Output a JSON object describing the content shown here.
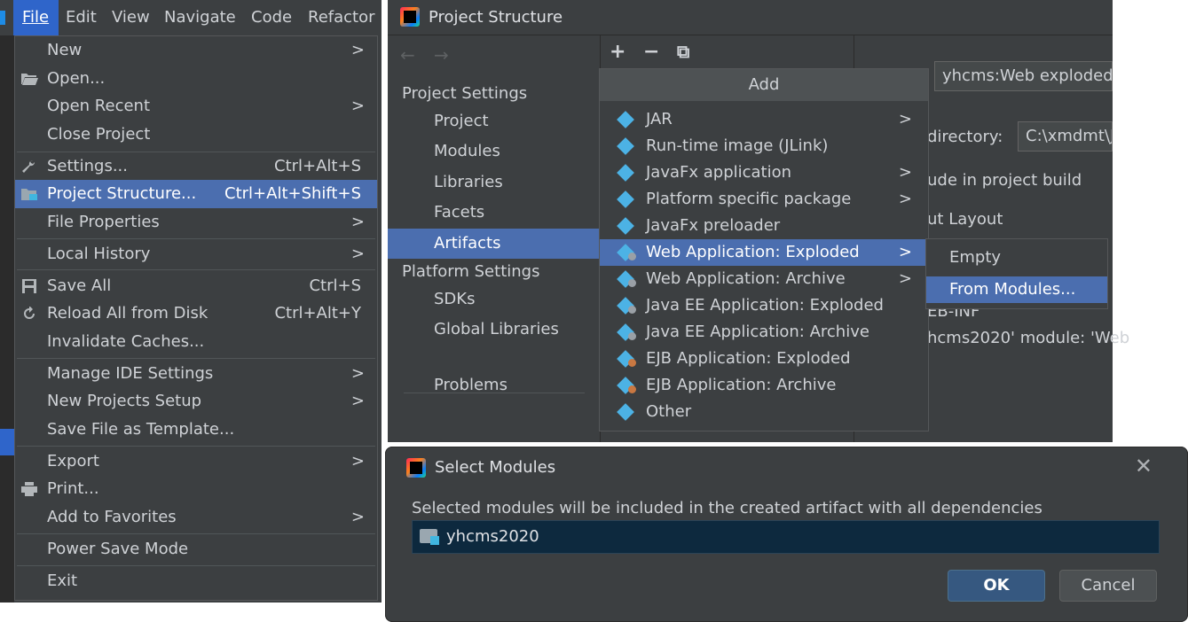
{
  "menubar": {
    "items": [
      "File",
      "Edit",
      "View",
      "Navigate",
      "Code",
      "Refactor"
    ],
    "active": "File"
  },
  "file_menu": {
    "items": [
      {
        "label": "New",
        "shortcut": "",
        "submenu": true,
        "icon": ""
      },
      {
        "label": "Open...",
        "shortcut": "",
        "submenu": false,
        "icon": "folder-open-icon"
      },
      {
        "label": "Open Recent",
        "shortcut": "",
        "submenu": true,
        "icon": ""
      },
      {
        "label": "Close Project",
        "shortcut": "",
        "submenu": false,
        "icon": ""
      },
      {
        "label": "Settings...",
        "shortcut": "Ctrl+Alt+S",
        "submenu": false,
        "icon": "wrench-icon"
      },
      {
        "label": "Project Structure...",
        "shortcut": "Ctrl+Alt+Shift+S",
        "submenu": false,
        "icon": "project-structure-icon",
        "selected": true
      },
      {
        "label": "File Properties",
        "shortcut": "",
        "submenu": true,
        "icon": ""
      },
      {
        "label": "Local History",
        "shortcut": "",
        "submenu": true,
        "icon": ""
      },
      {
        "label": "Save All",
        "shortcut": "Ctrl+S",
        "submenu": false,
        "icon": "save-icon"
      },
      {
        "label": "Reload All from Disk",
        "shortcut": "Ctrl+Alt+Y",
        "submenu": false,
        "icon": "reload-icon"
      },
      {
        "label": "Invalidate Caches...",
        "shortcut": "",
        "submenu": false,
        "icon": ""
      },
      {
        "label": "Manage IDE Settings",
        "shortcut": "",
        "submenu": true,
        "icon": ""
      },
      {
        "label": "New Projects Setup",
        "shortcut": "",
        "submenu": true,
        "icon": ""
      },
      {
        "label": "Save File as Template...",
        "shortcut": "",
        "submenu": false,
        "icon": ""
      },
      {
        "label": "Export",
        "shortcut": "",
        "submenu": true,
        "icon": ""
      },
      {
        "label": "Print...",
        "shortcut": "",
        "submenu": false,
        "icon": "print-icon"
      },
      {
        "label": "Add to Favorites",
        "shortcut": "",
        "submenu": true,
        "icon": ""
      },
      {
        "label": "Power Save Mode",
        "shortcut": "",
        "submenu": false,
        "icon": ""
      },
      {
        "label": "Exit",
        "shortcut": "",
        "submenu": false,
        "icon": ""
      }
    ]
  },
  "project_structure": {
    "title": "Project Structure",
    "sidebar": {
      "project_settings_header": "Project Settings",
      "project_settings": [
        "Project",
        "Modules",
        "Libraries",
        "Facets",
        "Artifacts"
      ],
      "selected": "Artifacts",
      "platform_settings_header": "Platform Settings",
      "platform_settings": [
        "SDKs",
        "Global Libraries"
      ],
      "problems": "Problems"
    },
    "toolbar": {
      "add": "+",
      "remove": "−",
      "copy": "⧉"
    },
    "right_panel": {
      "name_value": "yhcms:Web exploded",
      "output_dir_label": "directory:",
      "output_dir_value": "C:\\xmdmt\\J",
      "include_build": "ude in project build",
      "output_layout": "ut Layout",
      "web_inf": "EB-INF",
      "module_ref": "hcms2020' module: 'Web"
    },
    "add_popup": {
      "header": "Add",
      "items": [
        {
          "label": "JAR",
          "submenu": true,
          "badge": ""
        },
        {
          "label": "Run-time image (JLink)",
          "submenu": false,
          "badge": ""
        },
        {
          "label": "JavaFx application",
          "submenu": true,
          "badge": ""
        },
        {
          "label": "Platform specific package",
          "submenu": true,
          "badge": ""
        },
        {
          "label": "JavaFx preloader",
          "submenu": false,
          "badge": ""
        },
        {
          "label": "Web Application: Exploded",
          "submenu": true,
          "badge": "grey",
          "selected": true
        },
        {
          "label": "Web Application: Archive",
          "submenu": true,
          "badge": "grey"
        },
        {
          "label": "Java EE Application: Exploded",
          "submenu": false,
          "badge": "grey"
        },
        {
          "label": "Java EE Application: Archive",
          "submenu": false,
          "badge": "grey"
        },
        {
          "label": "EJB Application: Exploded",
          "submenu": false,
          "badge": "orange"
        },
        {
          "label": "EJB Application: Archive",
          "submenu": false,
          "badge": "orange"
        },
        {
          "label": "Other",
          "submenu": false,
          "badge": ""
        }
      ]
    },
    "sub_popup": {
      "items": [
        "Empty",
        "From Modules..."
      ],
      "selected": "From Modules..."
    }
  },
  "select_modules": {
    "title": "Select Modules",
    "description": "Selected modules will be included in the created artifact with all dependencies",
    "modules": [
      "yhcms2020"
    ],
    "ok": "OK",
    "cancel": "Cancel",
    "close_glyph": "✕"
  },
  "colors": {
    "panel_bg": "#3c3f41",
    "selection": "#4b6eaf",
    "menubar_active": "#2f65ca",
    "artifact_icon": "#4cb2e5"
  }
}
